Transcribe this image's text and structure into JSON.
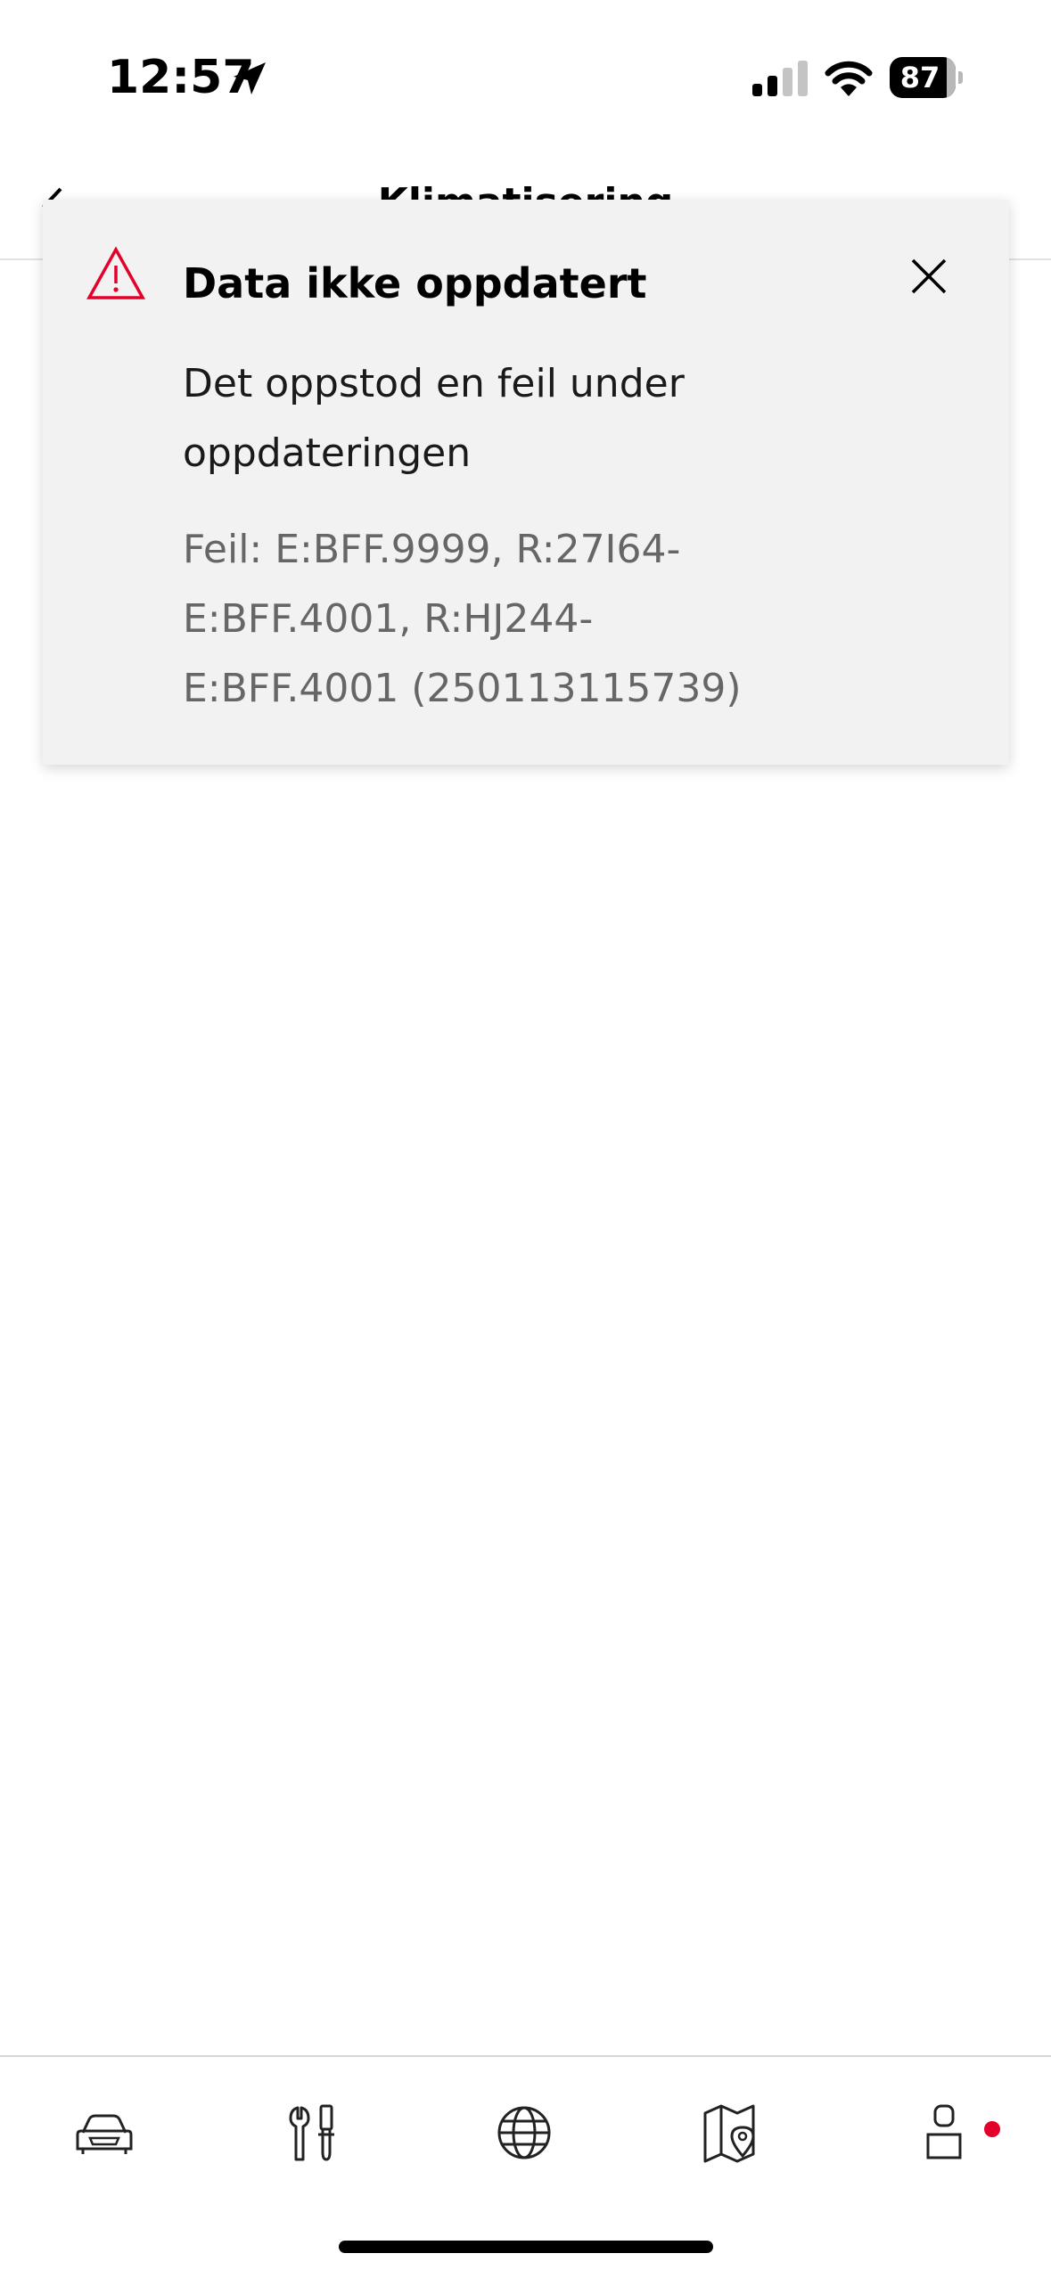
{
  "status_bar": {
    "time": "12:57",
    "battery": "87",
    "battery_level_percent": 87,
    "icons": [
      "location-arrow-icon",
      "cellular-signal-icon",
      "wifi-icon",
      "battery-icon"
    ]
  },
  "header": {
    "title": "Klimatisering",
    "back_icon": "chevron-left-icon"
  },
  "toast": {
    "title": "Data ikke oppdatert",
    "message": "Det oppstod en feil under oppdateringen",
    "error_lines": [
      "Feil: E:BFF.9999, R:27I64-",
      "E:BFF.4001, R:HJ244-",
      "E:BFF.4001 (250113115739)"
    ],
    "icon": "warning-triangle-icon",
    "close_icon": "close-icon",
    "accent_color": "#e4002b"
  },
  "tab_bar": {
    "items": [
      {
        "icon": "car-icon"
      },
      {
        "icon": "tools-icon"
      },
      {
        "icon": "globe-icon"
      },
      {
        "icon": "map-icon"
      },
      {
        "icon": "profile-icon",
        "has_notification": true
      }
    ],
    "notification_color": "#e4002b"
  }
}
